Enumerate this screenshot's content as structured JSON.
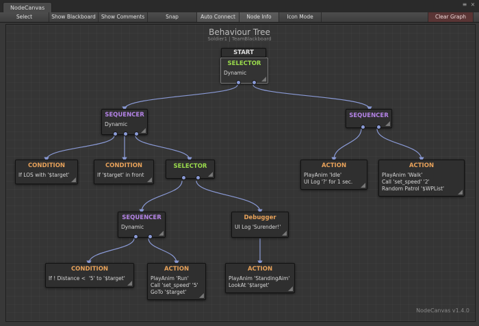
{
  "window": {
    "tab_title": "NodeCanvas"
  },
  "toolbar": {
    "select": "Select",
    "show_blackboard": "Show Blackboard",
    "show_comments": "Show Comments",
    "snap": "Snap",
    "auto_connect": "Auto Connect",
    "node_info": "Node Info",
    "icon_mode": "Icon Mode",
    "clear_graph": "Clear Graph"
  },
  "canvas": {
    "title": "Behaviour Tree",
    "subtitle": "Soldier1 | TeamBlackboard",
    "version": "NodeCanvas v1.4.0"
  },
  "nodes": {
    "start": {
      "title": "START"
    },
    "root_selector": {
      "title": "SELECTOR",
      "body": "Dynamic"
    },
    "seq_left": {
      "title": "SEQUENCER",
      "body": "Dynamic"
    },
    "seq_right": {
      "title": "SEQUENCER"
    },
    "cond_los": {
      "title": "CONDITION",
      "body": "If LOS with '$target'"
    },
    "cond_front": {
      "title": "CONDITION",
      "body": "If '$target' in front"
    },
    "mid_selector": {
      "title": "SELECTOR"
    },
    "action_idle": {
      "title": "ACTION",
      "body": "PlayAnim 'Idle'\nUI Log '?' for 1 sec."
    },
    "action_walk": {
      "title": "ACTION",
      "body": "PlayAnim 'Walk'\nCall 'set_speed' '2'\nRandom Patrol '$WPList'"
    },
    "seq_inner": {
      "title": "SEQUENCER",
      "body": "Dynamic"
    },
    "debugger": {
      "title": "Debugger",
      "body": "UI Log 'Surender!'"
    },
    "cond_distance": {
      "title": "CONDITION",
      "body": "If ! Distance <  '5' to '$target'"
    },
    "action_run": {
      "title": "ACTION",
      "body": "PlayAnim 'Run'\nCall 'set_speed' '5'\nGoTo '$target'"
    },
    "action_aim": {
      "title": "ACTION",
      "body": "PlayAnim 'StandingAim'\nLookAt '$target'"
    }
  },
  "colors": {
    "link": "#8b9bd8",
    "selector_title": "#9bdc4c",
    "sequencer_title": "#b483e6",
    "leaf_title": "#e8a25a"
  }
}
